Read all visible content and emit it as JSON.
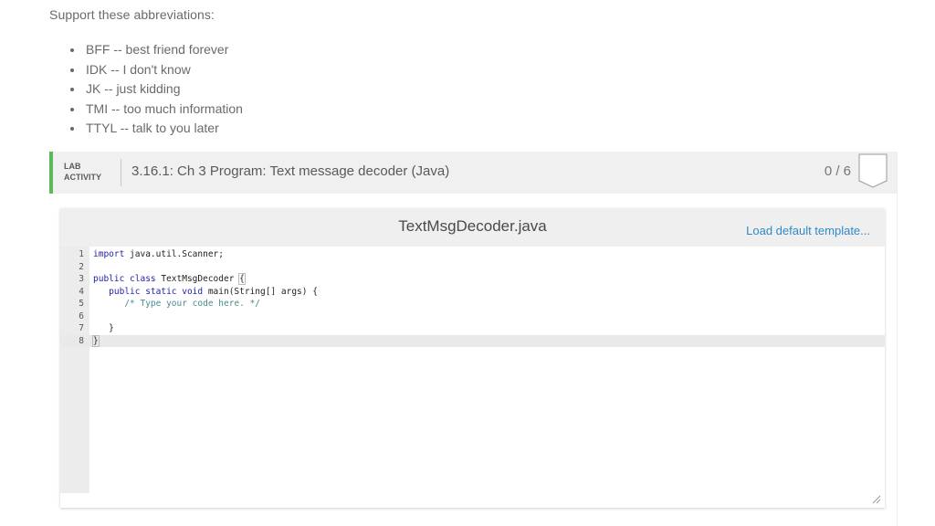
{
  "intro": "Support these abbreviations:",
  "abbreviations": [
    "BFF -- best friend forever",
    "IDK -- I don't know",
    "JK -- just kidding",
    "TMI -- too much information",
    "TTYL -- talk to you later"
  ],
  "lab": {
    "tag_line1": "LAB",
    "tag_line2": "ACTIVITY",
    "title": "3.16.1: Ch 3 Program: Text message decoder (Java)",
    "score": "0 / 6",
    "accent_color": "#5cb85c"
  },
  "editor": {
    "filename": "TextMsgDecoder.java",
    "load_default": "Load default template...",
    "active_line": 8,
    "lines": [
      {
        "n": "1",
        "parts": [
          {
            "t": "import",
            "c": "kw"
          },
          {
            "t": " java.util.Scanner;",
            "c": ""
          }
        ]
      },
      {
        "n": "2",
        "parts": []
      },
      {
        "n": "3",
        "parts": [
          {
            "t": "public class",
            "c": "kw"
          },
          {
            "t": " TextMsgDecoder ",
            "c": ""
          },
          {
            "t": "{",
            "c": "br-match"
          }
        ]
      },
      {
        "n": "4",
        "parts": [
          {
            "t": "   public static void",
            "c": "kw"
          },
          {
            "t": " main(String[] args) {",
            "c": ""
          }
        ]
      },
      {
        "n": "5",
        "parts": [
          {
            "t": "      /* Type your code here. */",
            "c": "cm"
          }
        ]
      },
      {
        "n": "6",
        "parts": []
      },
      {
        "n": "7",
        "parts": [
          {
            "t": "   }",
            "c": ""
          }
        ]
      },
      {
        "n": "8",
        "parts": [
          {
            "t": "}",
            "c": "br-match"
          }
        ]
      }
    ]
  }
}
